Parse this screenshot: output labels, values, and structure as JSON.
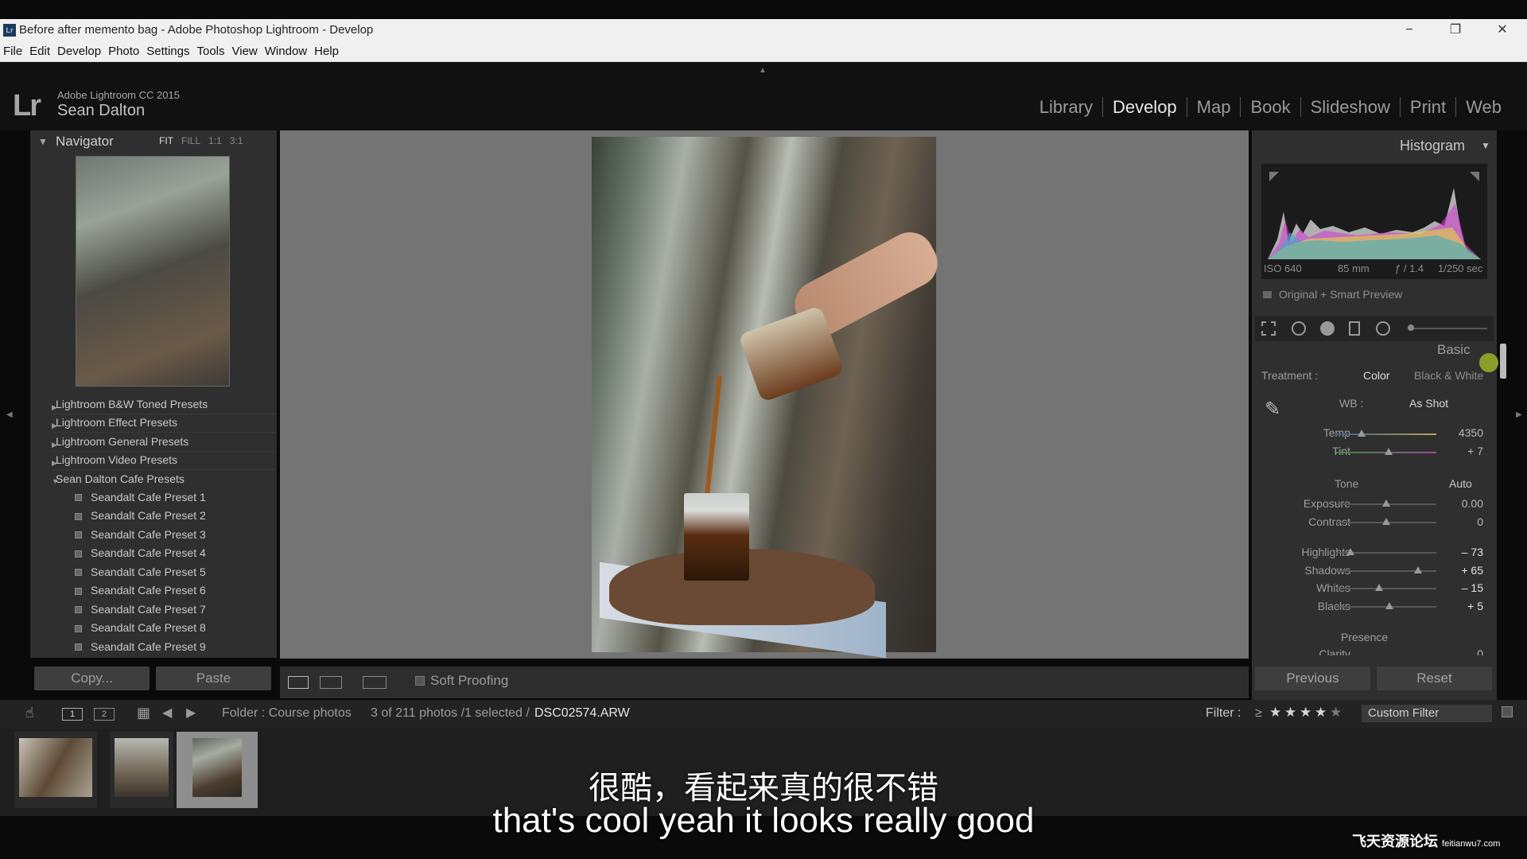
{
  "window": {
    "title": "Before after memento bag - Adobe Photoshop Lightroom - Develop",
    "app_icon": "Lr",
    "minimize": "−",
    "restore": "❐",
    "close": "✕"
  },
  "menu": [
    "File",
    "Edit",
    "Develop",
    "Photo",
    "Settings",
    "Tools",
    "View",
    "Window",
    "Help"
  ],
  "identity": {
    "logo": "Lr",
    "app_name": "Adobe Lightroom CC 2015",
    "user": "Sean Dalton"
  },
  "modules": [
    "Library",
    "Develop",
    "Map",
    "Book",
    "Slideshow",
    "Print",
    "Web"
  ],
  "active_module": "Develop",
  "navigator": {
    "title": "Navigator",
    "zoom": [
      "FIT",
      "FILL",
      "1:1",
      "3:1"
    ],
    "zoom_selected": "FIT"
  },
  "presets": {
    "folders": [
      "Lightroom B&W Toned Presets",
      "Lightroom Effect Presets",
      "Lightroom General Presets",
      "Lightroom Video Presets",
      "Sean Dalton Cafe Presets"
    ],
    "items": [
      "Seandalt Cafe Preset 1",
      "Seandalt Cafe Preset 2",
      "Seandalt Cafe Preset 3",
      "Seandalt Cafe Preset 4",
      "Seandalt Cafe Preset 5",
      "Seandalt Cafe Preset 6",
      "Seandalt Cafe Preset 7",
      "Seandalt Cafe Preset 8",
      "Seandalt Cafe Preset 9"
    ]
  },
  "left_buttons": {
    "copy": "Copy...",
    "paste": "Paste"
  },
  "toolbar": {
    "soft_proofing": "Soft Proofing"
  },
  "histogram": {
    "title": "Histogram",
    "iso": "ISO 640",
    "focal": "85 mm",
    "aperture": "ƒ / 1.4",
    "shutter": "1/250 sec",
    "preview": "Original + Smart Preview"
  },
  "basic": {
    "title": "Basic",
    "treatment_label": "Treatment :",
    "treatment_color": "Color",
    "treatment_bw": "Black & White",
    "wb_label": "WB :",
    "wb_value": "As Shot",
    "tone_label": "Tone",
    "auto_label": "Auto",
    "presence_label": "Presence",
    "clarity_label": "Clarity",
    "sliders": [
      {
        "label": "Temp",
        "value": "4350",
        "level": 0.25
      },
      {
        "label": "Tint",
        "value": "+ 7",
        "level": 0.52
      },
      {
        "label": "Exposure",
        "value": "0.00",
        "level": 0.5
      },
      {
        "label": "Contrast",
        "value": "0",
        "level": 0.5
      },
      {
        "label": "Highlights",
        "value": "– 73",
        "level": 0.14
      },
      {
        "label": "Shadows",
        "value": "+ 65",
        "level": 0.82
      },
      {
        "label": "Whites",
        "value": "– 15",
        "level": 0.43
      },
      {
        "label": "Blacks",
        "value": "+ 5",
        "level": 0.53
      }
    ],
    "clarity_value": "0"
  },
  "right_buttons": {
    "previous": "Previous",
    "reset": "Reset"
  },
  "filmbar": {
    "view1": "1",
    "view2": "2",
    "folder": "Folder : Course photos",
    "count": "3 of 211 photos /1 selected /",
    "filename": "DSC02574.ARW",
    "filter_label": "Filter :",
    "filter_op": "≥",
    "rating": 4,
    "rating_max": 5,
    "custom_filter": "Custom Filter"
  },
  "subtitles": {
    "zh": "很酷，看起来真的很不错",
    "en": "that's cool yeah it looks really good"
  },
  "watermark": {
    "main": "飞天资源论坛",
    "sub": "feitianwu7.com"
  }
}
